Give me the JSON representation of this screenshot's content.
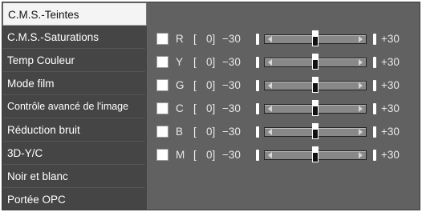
{
  "menu": {
    "items": [
      {
        "label": "C.M.S.-Teintes",
        "active": true
      },
      {
        "label": "C.M.S.-Saturations"
      },
      {
        "label": "Temp Couleur"
      },
      {
        "label": "Mode film"
      },
      {
        "label": "Contrôle avancé de l'image"
      },
      {
        "label": "Réduction bruit"
      },
      {
        "label": "3D-Y/C"
      },
      {
        "label": "Noir et blanc"
      },
      {
        "label": "Portée OPC"
      }
    ]
  },
  "sliders": {
    "open_bracket": "[",
    "min_label": "−30",
    "max_label": "+30",
    "rows": [
      {
        "letter": "R",
        "value": "0]",
        "level": 0
      },
      {
        "letter": "Y",
        "value": "0]",
        "level": 0
      },
      {
        "letter": "G",
        "value": "0]",
        "level": 0
      },
      {
        "letter": "C",
        "value": "0]",
        "level": 0
      },
      {
        "letter": "B",
        "value": "0]",
        "level": 0
      },
      {
        "letter": "M",
        "value": "0]",
        "level": 0
      }
    ]
  }
}
